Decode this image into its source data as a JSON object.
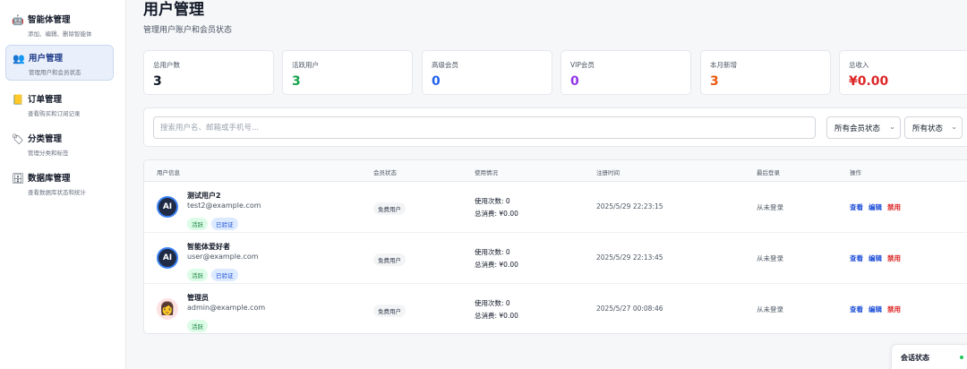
{
  "sidebar": {
    "items": [
      {
        "icon": "robot-icon",
        "glyph": "🤖",
        "title": "智能体管理",
        "subtitle": "添加、编辑、删除智能体"
      },
      {
        "icon": "users-icon",
        "glyph": "👥",
        "title": "用户管理",
        "subtitle": "管理用户和会员状态"
      },
      {
        "icon": "ledger-icon",
        "glyph": "📒",
        "title": "订单管理",
        "subtitle": "查看购买和订阅记录"
      },
      {
        "icon": "tag-icon",
        "glyph": "🏷",
        "title": "分类管理",
        "subtitle": "管理分类和标签"
      },
      {
        "icon": "database-icon",
        "glyph": "🗄",
        "title": "数据库管理",
        "subtitle": "查看数据库状态和统计"
      }
    ]
  },
  "header": {
    "title": "用户管理",
    "subtitle": "管理用户账户和会员状态"
  },
  "stats": [
    {
      "label": "总用户数",
      "value": "3",
      "color": "#111827"
    },
    {
      "label": "活跃用户",
      "value": "3",
      "color": "#16a34a"
    },
    {
      "label": "高级会员",
      "value": "0",
      "color": "#2563eb"
    },
    {
      "label": "VIP会员",
      "value": "0",
      "color": "#9333ea"
    },
    {
      "label": "本月新增",
      "value": "3",
      "color": "#ea580c"
    },
    {
      "label": "总收入",
      "value": "¥0.00",
      "color": "#dc2626"
    }
  ],
  "filters": {
    "search_placeholder": "搜索用户名、邮箱或手机号...",
    "member_status_selected": "所有会员状态",
    "status_selected": "所有状态",
    "chevron": "⌄"
  },
  "table": {
    "columns": [
      "用户信息",
      "会员状态",
      "使用情况",
      "注册时间",
      "最后登录",
      "操作"
    ],
    "rows": [
      {
        "avatar": "ai-avatar-icon",
        "avatar_text": "AI",
        "name": "测试用户2",
        "email": "test2@example.com",
        "badge_active": "活跃",
        "badge_verified": "已验证",
        "member": "免费用户",
        "usage_count": "使用次数: 0",
        "total_spent": "总消费: ¥0.00",
        "registered": "2025/5/29 22:23:15",
        "last_login": "从未登录",
        "view": "查看",
        "edit": "编辑",
        "ban": "禁用"
      },
      {
        "avatar": "ai-avatar-icon",
        "avatar_text": "AI",
        "name": "智能体爱好者",
        "email": "user@example.com",
        "badge_active": "活跃",
        "badge_verified": "已验证",
        "member": "免费用户",
        "usage_count": "使用次数: 0",
        "total_spent": "总消费: ¥0.00",
        "registered": "2025/5/29 22:13:45",
        "last_login": "从未登录",
        "view": "查看",
        "edit": "编辑",
        "ban": "禁用"
      },
      {
        "avatar": "admin-avatar-icon",
        "avatar_text": "👩",
        "name": "管理员",
        "email": "admin@example.com",
        "badge_active": "活跃",
        "member": "免费用户",
        "usage_count": "使用次数: 0",
        "total_spent": "总消费: ¥0.00",
        "registered": "2025/5/27 00:08:46",
        "last_login": "从未登录",
        "view": "查看",
        "edit": "编辑",
        "ban": "禁用"
      }
    ]
  },
  "session": {
    "title": "会话状态",
    "status_color": "#22c55e"
  }
}
